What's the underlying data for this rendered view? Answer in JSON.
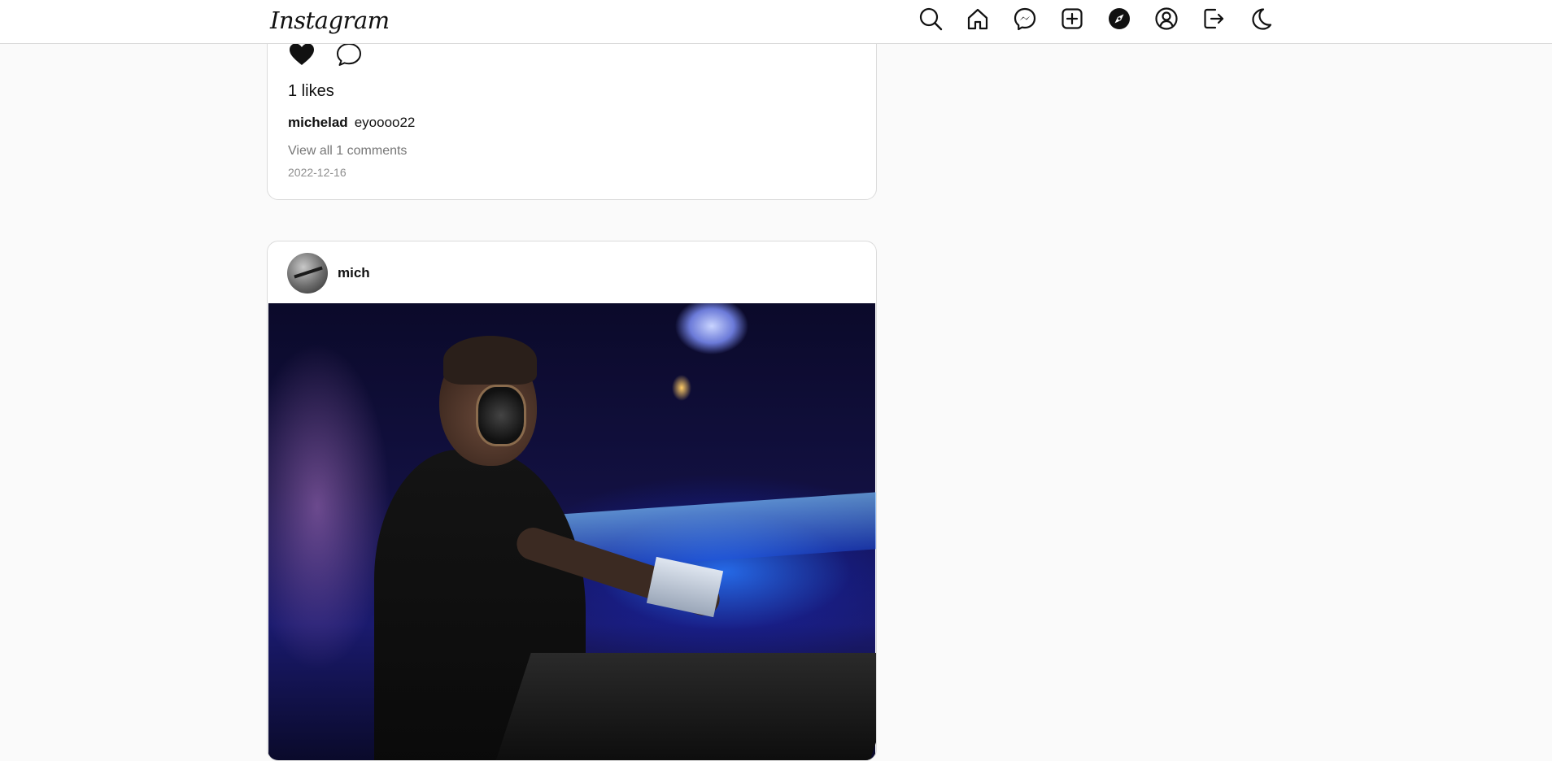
{
  "app": {
    "logo": "Instagram"
  },
  "nav": {
    "items": [
      {
        "name": "search-icon"
      },
      {
        "name": "home-icon"
      },
      {
        "name": "messenger-icon"
      },
      {
        "name": "new-post-icon"
      },
      {
        "name": "explore-icon"
      },
      {
        "name": "profile-icon"
      },
      {
        "name": "logout-icon"
      },
      {
        "name": "dark-mode-icon"
      }
    ]
  },
  "posts": [
    {
      "likes": "1 likes",
      "caption_user": "michelad",
      "caption_text": "eyoooo22",
      "view_comments": "View all 1 comments",
      "date": "2022-12-16"
    },
    {
      "username": "mich"
    }
  ]
}
